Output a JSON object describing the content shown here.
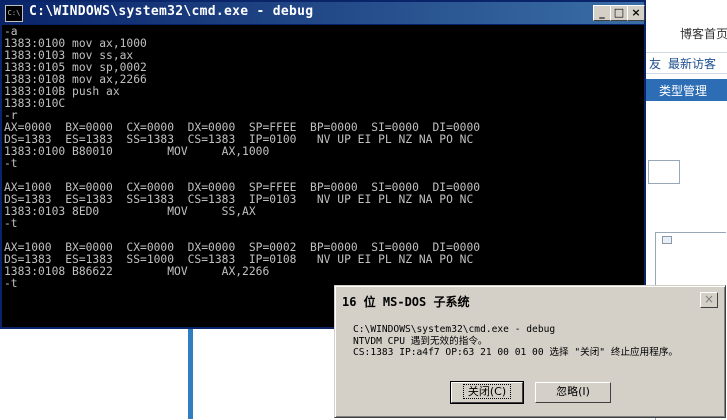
{
  "background": {
    "blog_title": "博客首页",
    "nav_items": [
      "友",
      "最新访客"
    ],
    "category_heading": "类型管理"
  },
  "cmd_window": {
    "title": "C:\\WINDOWS\\system32\\cmd.exe - debug",
    "icon_label": "C:\\",
    "lines": [
      "-a",
      "1383:0100 mov ax,1000",
      "1383:0103 mov ss,ax",
      "1383:0105 mov sp,0002",
      "1383:0108 mov ax,2266",
      "1383:010B push ax",
      "1383:010C",
      "-r",
      "AX=0000  BX=0000  CX=0000  DX=0000  SP=FFEE  BP=0000  SI=0000  DI=0000",
      "DS=1383  ES=1383  SS=1383  CS=1383  IP=0100   NV UP EI PL NZ NA PO NC",
      "1383:0100 B80010        MOV     AX,1000",
      "-t",
      "",
      "AX=1000  BX=0000  CX=0000  DX=0000  SP=FFEE  BP=0000  SI=0000  DI=0000",
      "DS=1383  ES=1383  SS=1383  CS=1383  IP=0103   NV UP EI PL NZ NA PO NC",
      "1383:0103 8ED0          MOV     SS,AX",
      "-t",
      "",
      "AX=1000  BX=0000  CX=0000  DX=0000  SP=0002  BP=0000  SI=0000  DI=0000",
      "DS=1383  ES=1383  SS=1000  CS=1383  IP=0108   NV UP EI PL NZ NA PO NC",
      "1383:0108 B86622        MOV     AX,2266",
      "-t"
    ]
  },
  "dialog": {
    "title": "16 位 MS-DOS 子系统",
    "message_lines": [
      "C:\\WINDOWS\\system32\\cmd.exe - debug",
      "NTVDM CPU 遇到无效的指令。",
      "CS:1383 IP:a4f7 OP:63 21 00 01 00 选择 \"关闭\" 终止应用程序。"
    ],
    "close_label": "关闭(C)",
    "ignore_label": "忽略(I)"
  }
}
